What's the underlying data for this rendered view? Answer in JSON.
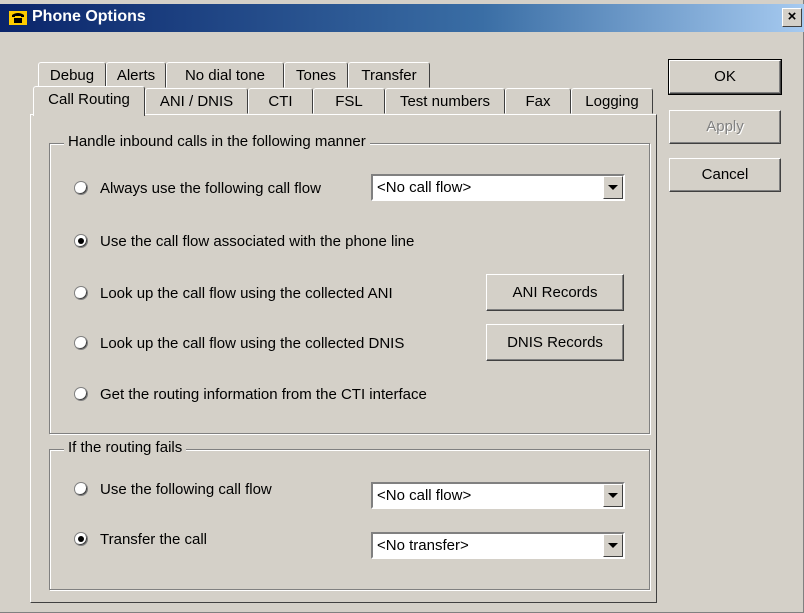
{
  "window": {
    "title": "Phone Options",
    "close_label": "×"
  },
  "tabs_row1": [
    "Debug",
    "Alerts",
    "No dial tone",
    "Tones",
    "Transfer"
  ],
  "tabs_row2": [
    "Call Routing",
    "ANI / DNIS",
    "CTI",
    "FSL",
    "Test numbers",
    "Fax",
    "Logging"
  ],
  "active_tab": "Call Routing",
  "inbound": {
    "legend": "Handle inbound calls in the following manner",
    "options": [
      {
        "label": "Always use the following call flow",
        "checked": false
      },
      {
        "label": "Use the call flow associated with the phone line",
        "checked": true
      },
      {
        "label": "Look up the call flow using the collected ANI",
        "checked": false
      },
      {
        "label": "Look up the call flow using the collected DNIS",
        "checked": false
      },
      {
        "label": "Get the routing information from the CTI interface",
        "checked": false
      }
    ],
    "always_combo_value": "<No call flow>",
    "ani_button": "ANI Records",
    "dnis_button": "DNIS Records"
  },
  "fail": {
    "legend": "If the routing fails",
    "options": [
      {
        "label": "Use the following call flow",
        "checked": false
      },
      {
        "label": "Transfer the call",
        "checked": true
      }
    ],
    "callflow_combo_value": "<No call flow>",
    "transfer_combo_value": "<No transfer>"
  },
  "buttons": {
    "ok": "OK",
    "apply": "Apply",
    "cancel": "Cancel"
  },
  "icons": {
    "title": "phone-icon",
    "dropdown": "chevron-down-icon"
  }
}
